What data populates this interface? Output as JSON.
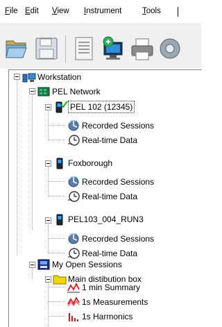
{
  "menu": {
    "file": {
      "first": "F",
      "rest": "ile"
    },
    "edit": {
      "first": "E",
      "rest": "dit"
    },
    "view": {
      "first": "V",
      "rest": "iew"
    },
    "instrument": {
      "first": "I",
      "rest": "nstrument"
    },
    "tools": {
      "first": "T",
      "rest": "ools"
    }
  },
  "toolbar": {
    "icons": [
      "open-folder-icon",
      "save-disk-icon",
      "document-icon",
      "connect-instrument-icon",
      "print-icon",
      "partial-icon"
    ]
  },
  "tree": {
    "root": "Workstation",
    "network": "PEL Network",
    "instruments": [
      {
        "name": "PEL 102 (12345)",
        "status": "connected",
        "recorded": "Recorded Sessions",
        "realtime": "Real-time Data"
      },
      {
        "name": "Foxborough",
        "recorded": "Recorded Sessions",
        "realtime": "Real-time Data"
      },
      {
        "name": "PEL103_004_RUN3",
        "recorded": "Recorded Sessions",
        "realtime": "Real-time Data"
      }
    ],
    "open_sessions": "My Open Sessions",
    "session_folder": "Main distibution box",
    "session_items": [
      "1 min Summary",
      "1s Measurements",
      "1s Harmonics"
    ]
  },
  "colors": {
    "toolbar_bg": "#f0f0f0",
    "panel_border": "#888888",
    "check_green": "#1fb21f",
    "chart_red": "#d81818"
  }
}
